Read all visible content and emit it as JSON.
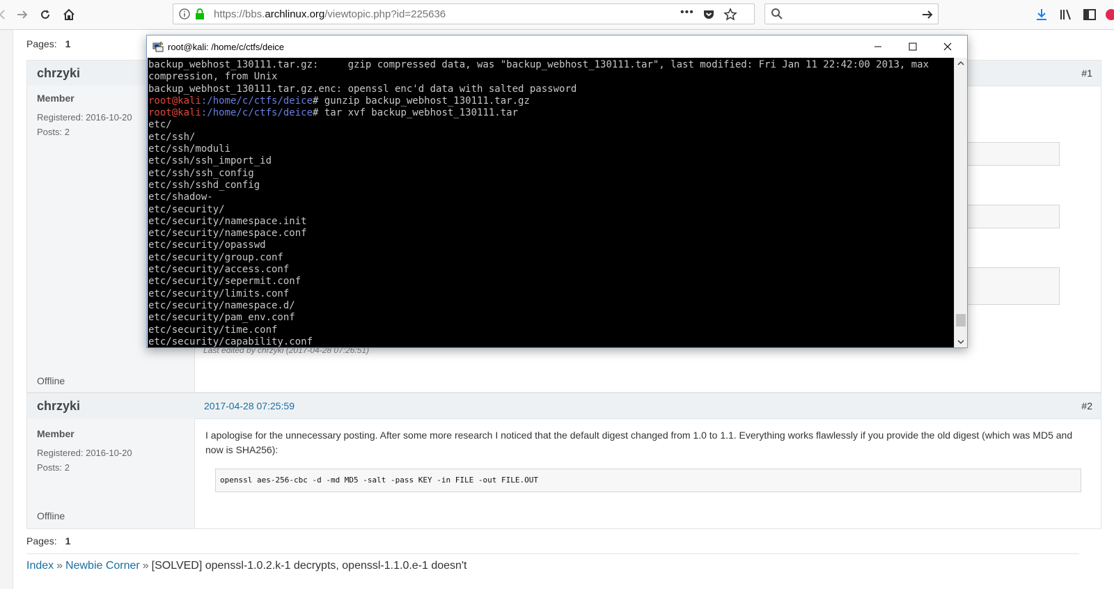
{
  "browser": {
    "url_prefix": "https://bbs.",
    "url_host": "archlinux.org",
    "url_path": "/viewtopic.php?id=225636",
    "search_placeholder": ""
  },
  "pages": {
    "label": "Pages:",
    "current": "1"
  },
  "posts": [
    {
      "author": "chrzyki",
      "number": "#1",
      "role": "Member",
      "registered": "Registered: 2016-10-20",
      "posts": "Posts: 2",
      "status": "Offline",
      "edited": "Last edited by chrzyki (2017-04-28 07:26:51)"
    },
    {
      "author": "chrzyki",
      "date": "2017-04-28 07:25:59",
      "number": "#2",
      "role": "Member",
      "registered": "Registered: 2016-10-20",
      "posts": "Posts: 2",
      "status": "Offline",
      "body": "I apologise for the unnecessary posting. After some more research I noticed that the default digest changed from 1.0 to 1.1. Everything works flawlessly if you provide the old digest (which was MD5 and now is SHA256):",
      "code": "openssl aes-256-cbc -d -md MD5 -salt -pass KEY -in FILE -out FILE.OUT"
    }
  ],
  "breadcrumb": {
    "index": "Index",
    "sep": "»",
    "forum": "Newbie Corner",
    "topic": "[SOLVED] openssl-1.0.2.k-1 decrypts, openssl-1.1.0.e-1 doesn't"
  },
  "terminal": {
    "title": "root@kali: /home/c/ctfs/deice",
    "prompt_user": "root@kali",
    "prompt_path": ":/home/c/ctfs/deice",
    "lines_top": [
      "backup_webhost_130111.tar.gz:     gzip compressed data, was \"backup_webhost_130111.tar\", last modified: Fri Jan 11 22:42:00 2013, max",
      "compression, from Unix",
      "backup_webhost_130111.tar.gz.enc: openssl enc'd data with salted password"
    ],
    "cmd1": "# gunzip backup_webhost_130111.tar.gz",
    "cmd2": "# tar xvf backup_webhost_130111.tar",
    "output": [
      "etc/",
      "etc/ssh/",
      "etc/ssh/moduli",
      "etc/ssh/ssh_import_id",
      "etc/ssh/ssh_config",
      "etc/ssh/sshd_config",
      "etc/shadow-",
      "etc/security/",
      "etc/security/namespace.init",
      "etc/security/namespace.conf",
      "etc/security/opasswd",
      "etc/security/group.conf",
      "etc/security/access.conf",
      "etc/security/sepermit.conf",
      "etc/security/limits.conf",
      "etc/security/namespace.d/",
      "etc/security/pam_env.conf",
      "etc/security/time.conf",
      "etc/security/capability.conf"
    ]
  }
}
